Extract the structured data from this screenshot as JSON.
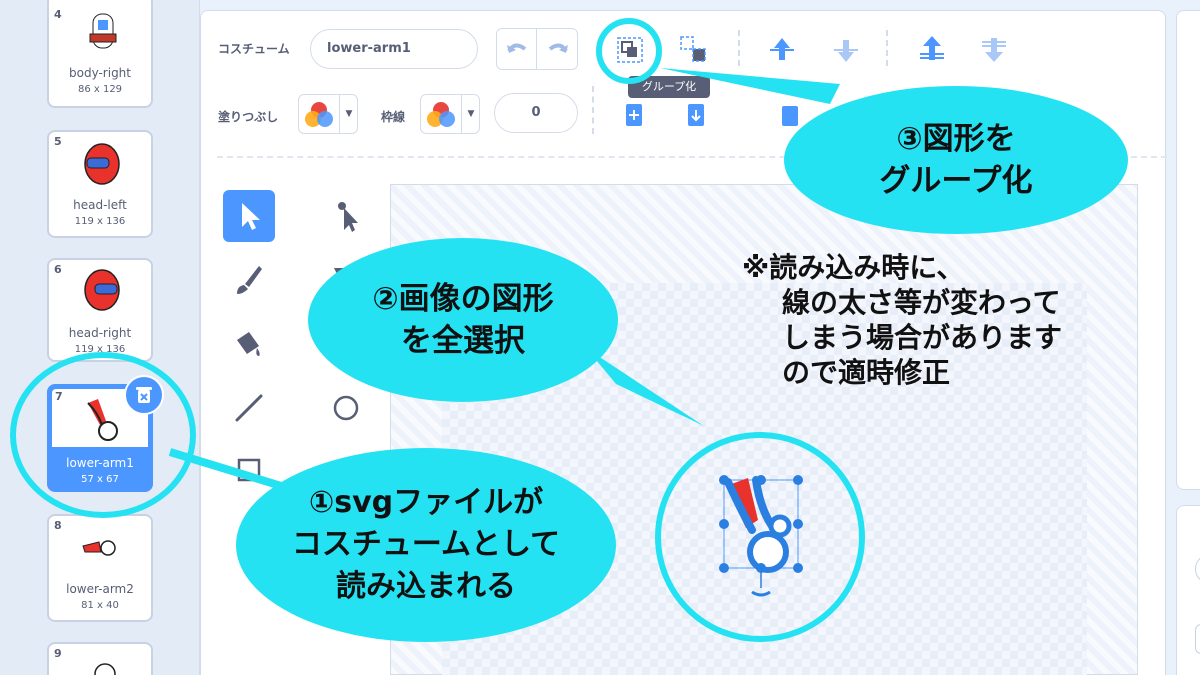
{
  "costumes": [
    {
      "number": "4",
      "name": "body-right",
      "size": "86 x 129"
    },
    {
      "number": "5",
      "name": "head-left",
      "size": "119 x 136"
    },
    {
      "number": "6",
      "name": "head-right",
      "size": "119 x 136"
    },
    {
      "number": "7",
      "name": "lower-arm1",
      "size": "57 x 67"
    },
    {
      "number": "8",
      "name": "lower-arm2",
      "size": "81 x 40"
    },
    {
      "number": "9",
      "name": "",
      "size": ""
    }
  ],
  "toolbar": {
    "costume_label": "コスチューム",
    "costume_name": "lower-arm1",
    "fill_label": "塗りつぶし",
    "outline_label": "枠線",
    "outline_width": "0",
    "group_tooltip": "グループ化"
  },
  "annotations": {
    "step1": [
      "①svgファイルが",
      "コスチュームとして",
      "読み込まれる"
    ],
    "step2": [
      "②画像の図形",
      "を全選択"
    ],
    "step3": [
      "③図形を",
      "グループ化"
    ],
    "note": [
      "※読み込み時に、",
      "線の太さ等が変わって",
      "しまう場合があります",
      "ので適時修正"
    ]
  },
  "colors": {
    "accent": "#4c97ff",
    "highlight": "#25e2f3",
    "costume_red": "#e8322b"
  },
  "icons": [
    "undo-icon",
    "redo-icon",
    "group-icon",
    "ungroup-icon",
    "forward-icon",
    "backward-icon",
    "front-icon",
    "back-icon",
    "delete-icon",
    "select-icon",
    "reshape-icon",
    "brush-icon",
    "eraser-icon",
    "fill-icon",
    "line-icon",
    "circle-icon",
    "rect-icon"
  ]
}
